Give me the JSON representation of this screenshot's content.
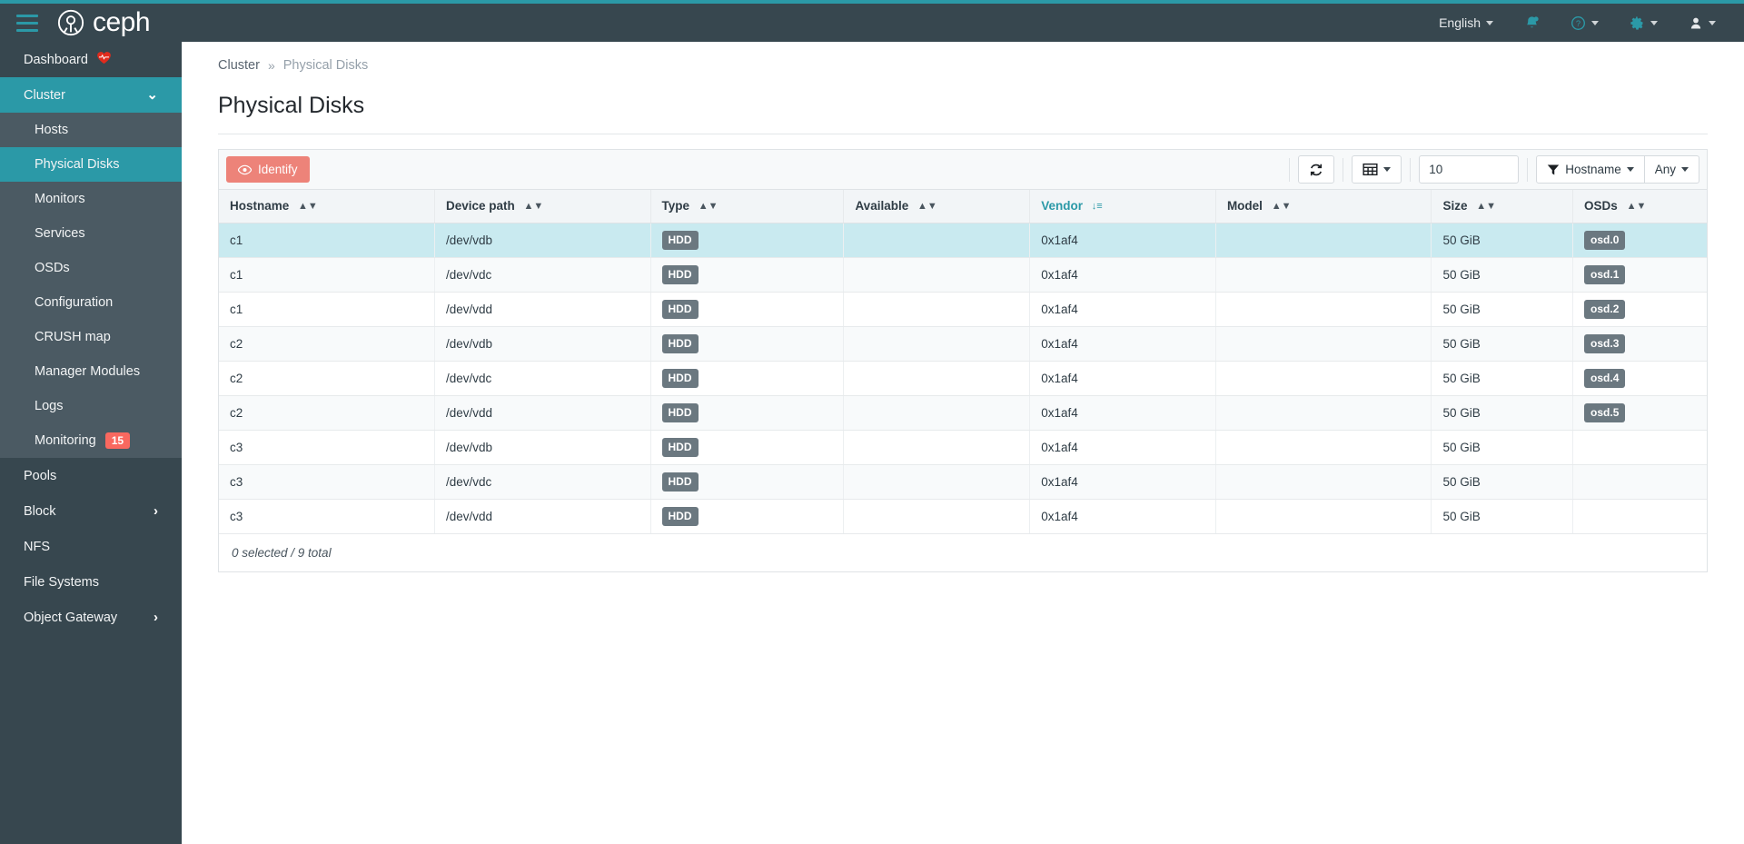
{
  "topbar": {
    "menu_icon": "hamburger-icon",
    "brand": "ceph",
    "language": "English",
    "notifications_icon": "bell-icon",
    "help_icon": "help-circle-icon",
    "settings_icon": "gear-icon",
    "user_icon": "user-icon"
  },
  "sidebar": {
    "dashboard": {
      "label": "Dashboard",
      "icon": "heart-pulse-icon"
    },
    "cluster": {
      "label": "Cluster",
      "icon": "chevron-down-icon",
      "expanded": true
    },
    "cluster_items": [
      {
        "label": "Hosts",
        "active": false
      },
      {
        "label": "Physical Disks",
        "active": true
      },
      {
        "label": "Monitors",
        "active": false
      },
      {
        "label": "Services",
        "active": false
      },
      {
        "label": "OSDs",
        "active": false
      },
      {
        "label": "Configuration",
        "active": false
      },
      {
        "label": "CRUSH map",
        "active": false
      },
      {
        "label": "Manager Modules",
        "active": false
      },
      {
        "label": "Logs",
        "active": false
      },
      {
        "label": "Monitoring",
        "active": false,
        "badge": "15"
      }
    ],
    "bottom_items": [
      {
        "label": "Pools",
        "expandable": false
      },
      {
        "label": "Block",
        "expandable": true
      },
      {
        "label": "NFS",
        "expandable": false
      },
      {
        "label": "File Systems",
        "expandable": false
      },
      {
        "label": "Object Gateway",
        "expandable": true
      }
    ]
  },
  "breadcrumb": {
    "parent": "Cluster",
    "separator": "»",
    "current": "Physical Disks"
  },
  "page": {
    "title": "Physical Disks"
  },
  "toolbar": {
    "identify_label": "Identify",
    "identify_icon": "eye-icon",
    "refresh_icon": "refresh-icon",
    "columns_icon": "table-columns-icon",
    "page_size_value": "10",
    "page_size_placeholder": "",
    "filter_icon": "funnel-icon",
    "filter_column": "Hostname",
    "filter_value": "Any"
  },
  "table": {
    "columns": [
      {
        "label": "Hostname",
        "sorted": false
      },
      {
        "label": "Device path",
        "sorted": false
      },
      {
        "label": "Type",
        "sorted": false
      },
      {
        "label": "Available",
        "sorted": false
      },
      {
        "label": "Vendor",
        "sorted": true,
        "sort_dir": "desc"
      },
      {
        "label": "Model",
        "sorted": false
      },
      {
        "label": "Size",
        "sorted": false
      },
      {
        "label": "OSDs",
        "sorted": false
      }
    ],
    "rows": [
      {
        "hostname": "c1",
        "device_path": "/dev/vdb",
        "type": "HDD",
        "available": "",
        "vendor": "0x1af4",
        "model": "",
        "size": "50 GiB",
        "osds": "osd.0",
        "selected": true
      },
      {
        "hostname": "c1",
        "device_path": "/dev/vdc",
        "type": "HDD",
        "available": "",
        "vendor": "0x1af4",
        "model": "",
        "size": "50 GiB",
        "osds": "osd.1",
        "selected": false
      },
      {
        "hostname": "c1",
        "device_path": "/dev/vdd",
        "type": "HDD",
        "available": "",
        "vendor": "0x1af4",
        "model": "",
        "size": "50 GiB",
        "osds": "osd.2",
        "selected": false
      },
      {
        "hostname": "c2",
        "device_path": "/dev/vdb",
        "type": "HDD",
        "available": "",
        "vendor": "0x1af4",
        "model": "",
        "size": "50 GiB",
        "osds": "osd.3",
        "selected": false
      },
      {
        "hostname": "c2",
        "device_path": "/dev/vdc",
        "type": "HDD",
        "available": "",
        "vendor": "0x1af4",
        "model": "",
        "size": "50 GiB",
        "osds": "osd.4",
        "selected": false
      },
      {
        "hostname": "c2",
        "device_path": "/dev/vdd",
        "type": "HDD",
        "available": "",
        "vendor": "0x1af4",
        "model": "",
        "size": "50 GiB",
        "osds": "osd.5",
        "selected": false
      },
      {
        "hostname": "c3",
        "device_path": "/dev/vdb",
        "type": "HDD",
        "available": "",
        "vendor": "0x1af4",
        "model": "",
        "size": "50 GiB",
        "osds": "",
        "selected": false
      },
      {
        "hostname": "c3",
        "device_path": "/dev/vdc",
        "type": "HDD",
        "available": "",
        "vendor": "0x1af4",
        "model": "",
        "size": "50 GiB",
        "osds": "",
        "selected": false
      },
      {
        "hostname": "c3",
        "device_path": "/dev/vdd",
        "type": "HDD",
        "available": "",
        "vendor": "0x1af4",
        "model": "",
        "size": "50 GiB",
        "osds": "",
        "selected": false
      }
    ],
    "footer": "0 selected / 9 total"
  },
  "colors": {
    "brand_teal": "#2b99a7",
    "sidebar_dark": "#37474f",
    "sidebar_sub": "#4b5a63",
    "identify_salmon": "#ed8379",
    "badge_red": "#f9685f",
    "chip_gray": "#6b7880",
    "row_selected": "#c9eaf0"
  }
}
